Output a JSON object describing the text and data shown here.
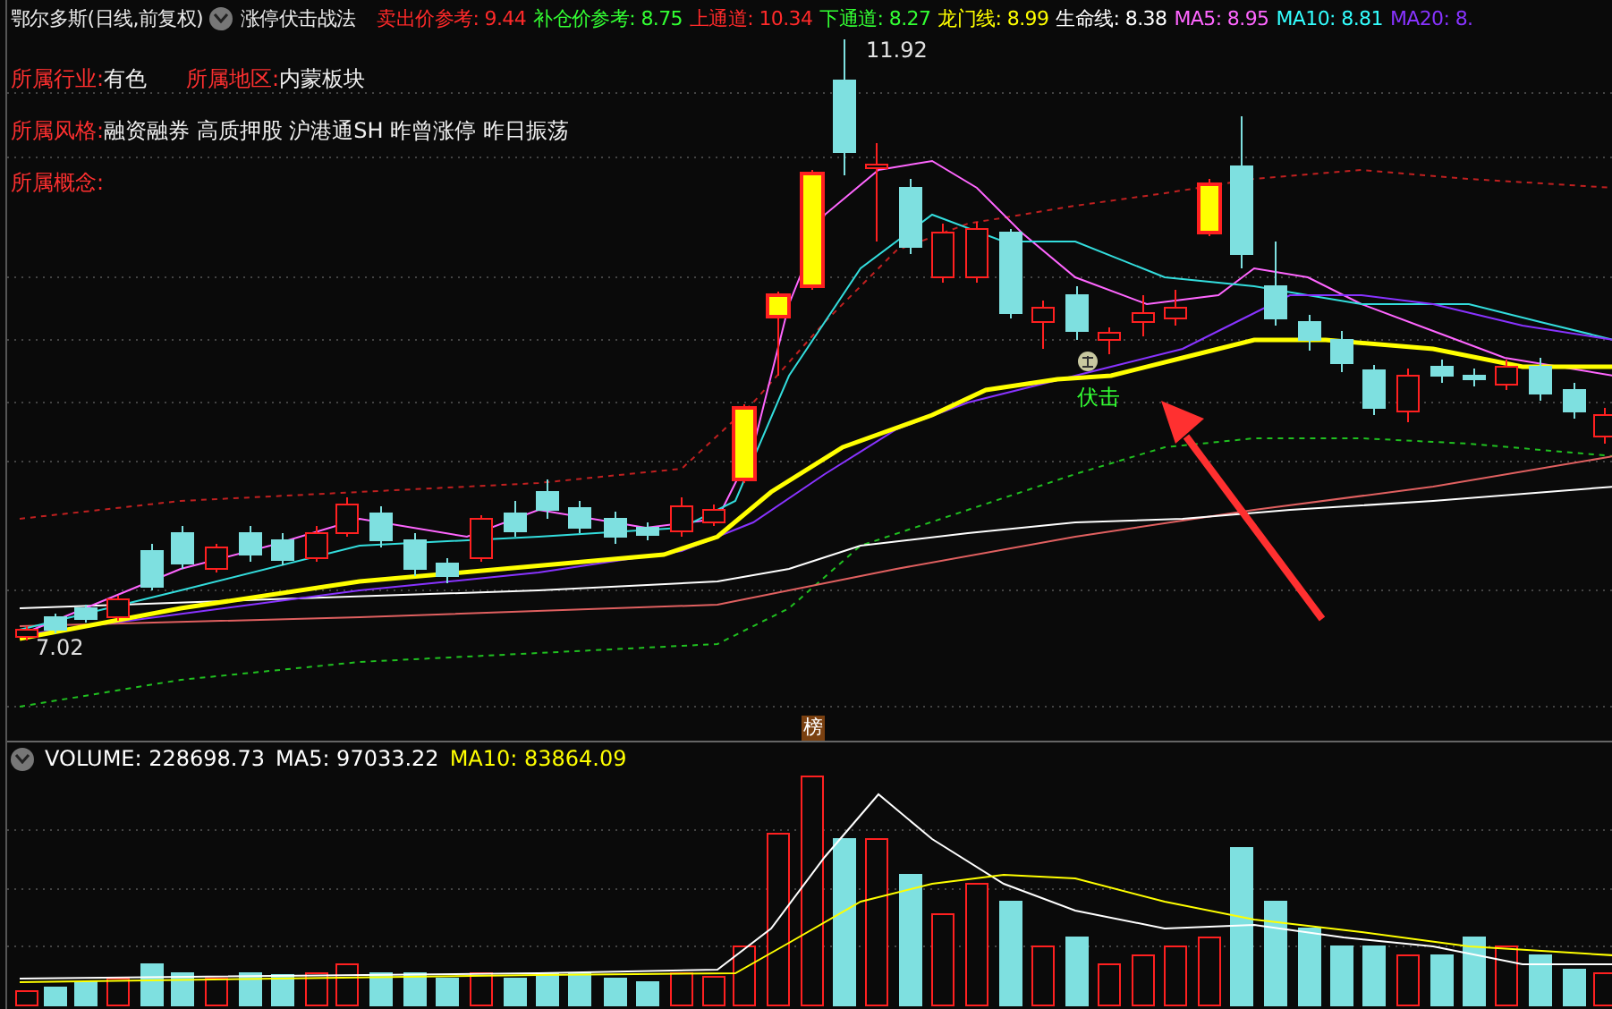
{
  "header": {
    "stock": "鄂尔多斯(日线,前复权)",
    "indicator": "涨停伏击战法",
    "readings": [
      {
        "text": "卖出价参考: 9.44",
        "color": "#ff2a2a"
      },
      {
        "text": "补仓价参考: 8.75",
        "color": "#33ff33"
      },
      {
        "text": "上通道: 10.34",
        "color": "#ff2a2a"
      },
      {
        "text": "下通道: 8.27",
        "color": "#33ff33"
      },
      {
        "text": "龙门线: 8.99",
        "color": "#ffff00"
      },
      {
        "text": "生命线: 8.38",
        "color": "#ffffff"
      },
      {
        "text": "MA5: 8.95",
        "color": "#ff66ff"
      },
      {
        "text": "MA10: 8.81",
        "color": "#33ffff"
      },
      {
        "text": "MA20: 8.",
        "color": "#8833ff"
      }
    ]
  },
  "info": [
    [
      {
        "label": "所属行业:",
        "value": "有色"
      },
      {
        "label": "所属地区:",
        "value": "内蒙板块"
      }
    ],
    [
      {
        "label": "所属风格:",
        "value": "融资融券 高质押股 沪港通SH 昨曾涨停 昨日振荡"
      }
    ],
    [
      {
        "label": "所属概念:"
      }
    ]
  ],
  "price_chart": {
    "high_label": "11.92",
    "low_label": "7.02",
    "signal_label": "伏击",
    "tag": "榜"
  },
  "volume": {
    "readings": [
      {
        "text": "VOLUME: 228698.73",
        "color": "#ffffff"
      },
      {
        "text": "MA5: 97033.22",
        "color": "#ffffff"
      },
      {
        "text": "MA10: 83864.09",
        "color": "#ffff00"
      }
    ]
  }
}
